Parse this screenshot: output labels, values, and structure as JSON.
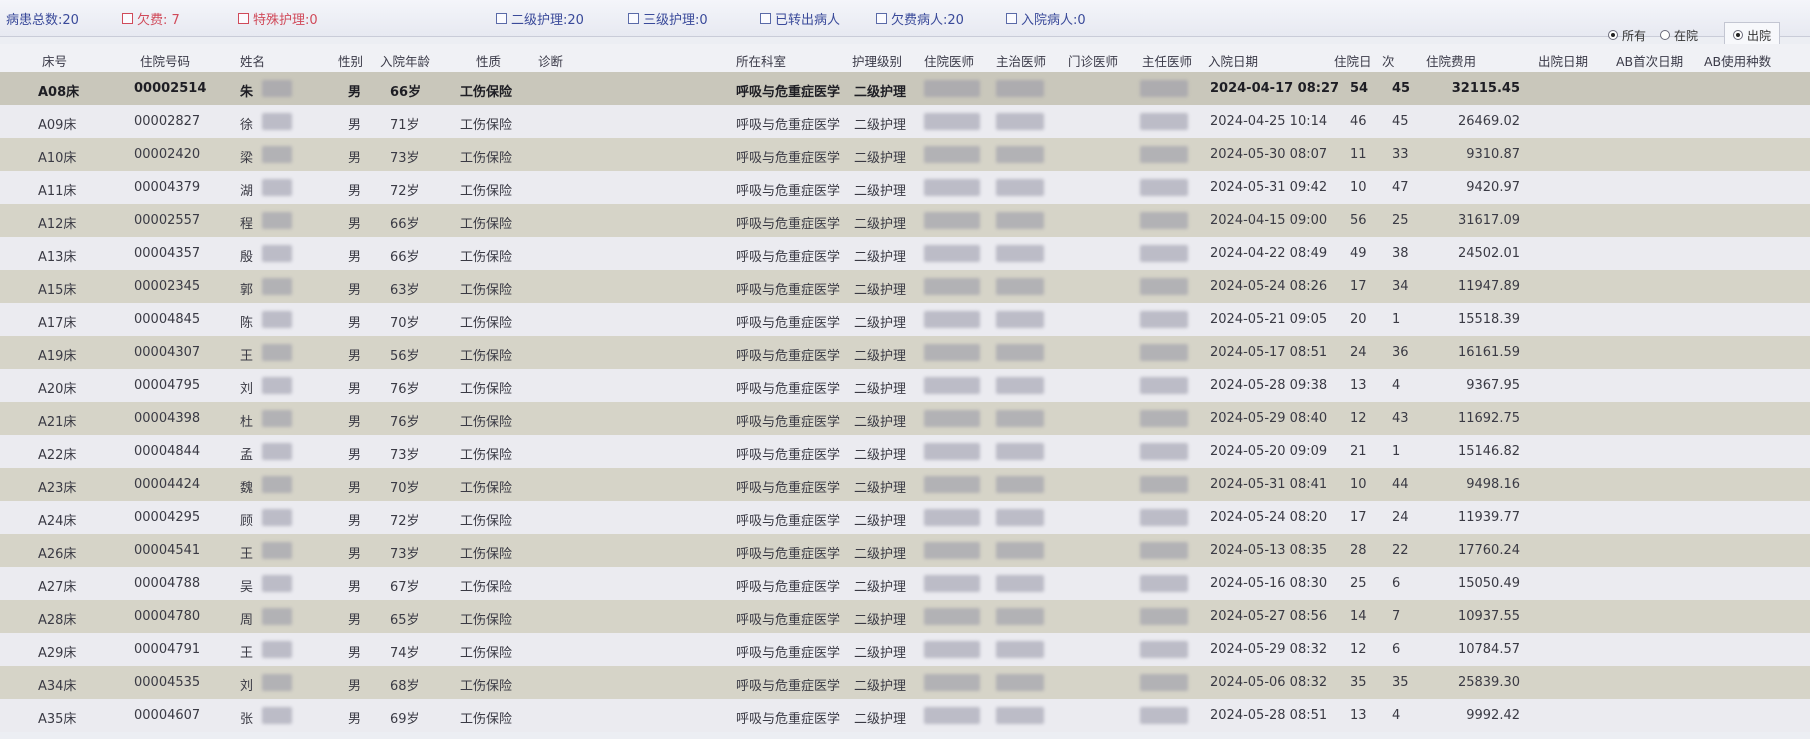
{
  "filters": {
    "total_label": "病患总数:20",
    "cb_items": [
      {
        "label": "欠费: 7",
        "color": "red"
      },
      {
        "label": "特殊护理:0",
        "color": "red"
      },
      {
        "label": "二级护理:20",
        "color": "blue"
      },
      {
        "label": "三级护理:0",
        "color": "blue"
      },
      {
        "label": "已转出病人",
        "color": "blue"
      },
      {
        "label": "欠费病人:20",
        "color": "blue"
      },
      {
        "label": "入院病人:0",
        "color": "blue"
      }
    ],
    "radio_options": [
      "所有",
      "在院",
      "出院"
    ]
  },
  "table": {
    "headers": [
      "床号",
      "住院号码",
      "姓名",
      "性别",
      "入院年龄",
      "性质",
      "诊断",
      "所在科室",
      "护理级别",
      "住院医师",
      "主治医师",
      "门诊医师",
      "主任医师",
      "入院日期",
      "住院日",
      "次",
      "住院费用",
      "出院日期",
      "AB首次日期",
      "AB使用种数"
    ],
    "rows": [
      {
        "bed": "A08床",
        "no": "00002514",
        "name": "朱",
        "sex": "男",
        "age": "66岁",
        "type": "工伤保险",
        "dept": "呼吸与危重症医学",
        "care": "二级护理",
        "date": "2024-04-17 08:27",
        "days": "54",
        "times": "45",
        "fee": "32115.45"
      },
      {
        "bed": "A09床",
        "no": "00002827",
        "name": "徐",
        "sex": "男",
        "age": "71岁",
        "type": "工伤保险",
        "dept": "呼吸与危重症医学",
        "care": "二级护理",
        "date": "2024-04-25 10:14",
        "days": "46",
        "times": "45",
        "fee": "26469.02"
      },
      {
        "bed": "A10床",
        "no": "00002420",
        "name": "梁",
        "sex": "男",
        "age": "73岁",
        "type": "工伤保险",
        "dept": "呼吸与危重症医学",
        "care": "二级护理",
        "date": "2024-05-30 08:07",
        "days": "11",
        "times": "33",
        "fee": "9310.87"
      },
      {
        "bed": "A11床",
        "no": "00004379",
        "name": "湖",
        "sex": "男",
        "age": "72岁",
        "type": "工伤保险",
        "dept": "呼吸与危重症医学",
        "care": "二级护理",
        "date": "2024-05-31 09:42",
        "days": "10",
        "times": "47",
        "fee": "9420.97"
      },
      {
        "bed": "A12床",
        "no": "00002557",
        "name": "程",
        "sex": "男",
        "age": "66岁",
        "type": "工伤保险",
        "dept": "呼吸与危重症医学",
        "care": "二级护理",
        "date": "2024-04-15 09:00",
        "days": "56",
        "times": "25",
        "fee": "31617.09"
      },
      {
        "bed": "A13床",
        "no": "00004357",
        "name": "殷",
        "sex": "男",
        "age": "66岁",
        "type": "工伤保险",
        "dept": "呼吸与危重症医学",
        "care": "二级护理",
        "date": "2024-04-22 08:49",
        "days": "49",
        "times": "38",
        "fee": "24502.01"
      },
      {
        "bed": "A15床",
        "no": "00002345",
        "name": "郭",
        "sex": "男",
        "age": "63岁",
        "type": "工伤保险",
        "dept": "呼吸与危重症医学",
        "care": "二级护理",
        "date": "2024-05-24 08:26",
        "days": "17",
        "times": "34",
        "fee": "11947.89"
      },
      {
        "bed": "A17床",
        "no": "00004845",
        "name": "陈",
        "sex": "男",
        "age": "70岁",
        "type": "工伤保险",
        "dept": "呼吸与危重症医学",
        "care": "二级护理",
        "date": "2024-05-21 09:05",
        "days": "20",
        "times": "1",
        "fee": "15518.39"
      },
      {
        "bed": "A19床",
        "no": "00004307",
        "name": "王",
        "sex": "男",
        "age": "56岁",
        "type": "工伤保险",
        "dept": "呼吸与危重症医学",
        "care": "二级护理",
        "date": "2024-05-17 08:51",
        "days": "24",
        "times": "36",
        "fee": "16161.59"
      },
      {
        "bed": "A20床",
        "no": "00004795",
        "name": "刘",
        "sex": "男",
        "age": "76岁",
        "type": "工伤保险",
        "dept": "呼吸与危重症医学",
        "care": "二级护理",
        "date": "2024-05-28 09:38",
        "days": "13",
        "times": "4",
        "fee": "9367.95"
      },
      {
        "bed": "A21床",
        "no": "00004398",
        "name": "杜",
        "sex": "男",
        "age": "76岁",
        "type": "工伤保险",
        "dept": "呼吸与危重症医学",
        "care": "二级护理",
        "date": "2024-05-29 08:40",
        "days": "12",
        "times": "43",
        "fee": "11692.75"
      },
      {
        "bed": "A22床",
        "no": "00004844",
        "name": "孟",
        "sex": "男",
        "age": "73岁",
        "type": "工伤保险",
        "dept": "呼吸与危重症医学",
        "care": "二级护理",
        "date": "2024-05-20 09:09",
        "days": "21",
        "times": "1",
        "fee": "15146.82"
      },
      {
        "bed": "A23床",
        "no": "00004424",
        "name": "魏",
        "sex": "男",
        "age": "70岁",
        "type": "工伤保险",
        "dept": "呼吸与危重症医学",
        "care": "二级护理",
        "date": "2024-05-31 08:41",
        "days": "10",
        "times": "44",
        "fee": "9498.16"
      },
      {
        "bed": "A24床",
        "no": "00004295",
        "name": "顾",
        "sex": "男",
        "age": "72岁",
        "type": "工伤保险",
        "dept": "呼吸与危重症医学",
        "care": "二级护理",
        "date": "2024-05-24 08:20",
        "days": "17",
        "times": "24",
        "fee": "11939.77"
      },
      {
        "bed": "A26床",
        "no": "00004541",
        "name": "王",
        "sex": "男",
        "age": "73岁",
        "type": "工伤保险",
        "dept": "呼吸与危重症医学",
        "care": "二级护理",
        "date": "2024-05-13 08:35",
        "days": "28",
        "times": "22",
        "fee": "17760.24"
      },
      {
        "bed": "A27床",
        "no": "00004788",
        "name": "吴",
        "sex": "男",
        "age": "67岁",
        "type": "工伤保险",
        "dept": "呼吸与危重症医学",
        "care": "二级护理",
        "date": "2024-05-16 08:30",
        "days": "25",
        "times": "6",
        "fee": "15050.49"
      },
      {
        "bed": "A28床",
        "no": "00004780",
        "name": "周",
        "sex": "男",
        "age": "65岁",
        "type": "工伤保险",
        "dept": "呼吸与危重症医学",
        "care": "二级护理",
        "date": "2024-05-27 08:56",
        "days": "14",
        "times": "7",
        "fee": "10937.55"
      },
      {
        "bed": "A29床",
        "no": "00004791",
        "name": "王",
        "sex": "男",
        "age": "74岁",
        "type": "工伤保险",
        "dept": "呼吸与危重症医学",
        "care": "二级护理",
        "date": "2024-05-29 08:32",
        "days": "12",
        "times": "6",
        "fee": "10784.57"
      },
      {
        "bed": "A34床",
        "no": "00004535",
        "name": "刘",
        "sex": "男",
        "age": "68岁",
        "type": "工伤保险",
        "dept": "呼吸与危重症医学",
        "care": "二级护理",
        "date": "2024-05-06 08:32",
        "days": "35",
        "times": "35",
        "fee": "25839.30"
      },
      {
        "bed": "A35床",
        "no": "00004607",
        "name": "张",
        "sex": "男",
        "age": "69岁",
        "type": "工伤保险",
        "dept": "呼吸与危重症医学",
        "care": "二级护理",
        "date": "2024-05-28 08:51",
        "days": "13",
        "times": "4",
        "fee": "9992.42"
      }
    ]
  }
}
